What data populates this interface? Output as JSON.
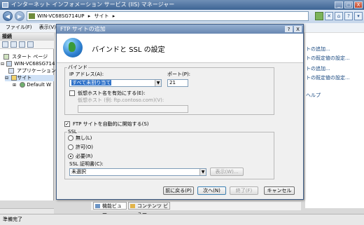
{
  "window": {
    "title": "インターネット インフォメーション サービス (IIS) マネージャー",
    "buttons": [
      "_",
      "□",
      "X"
    ]
  },
  "address": {
    "path": [
      "WIN-VC68SG714UP",
      "サイト"
    ],
    "separator": "▸"
  },
  "menu": {
    "items": [
      "ファイル(F)",
      "表示(V)",
      "?"
    ]
  },
  "connections": {
    "header": "接続",
    "tree": [
      {
        "label": "スタート ページ",
        "level": 1
      },
      {
        "label": "WIN-VC68SG714",
        "level": 1
      },
      {
        "label": "アプリケーション",
        "level": 2
      },
      {
        "label": "サイト",
        "level": 2
      },
      {
        "label": "Default W",
        "level": 3
      }
    ]
  },
  "actions": {
    "items": [
      "トの追加...",
      "トの既定値の設定...",
      "トの追加...",
      "トの既定値の設定...",
      "ヘルプ"
    ]
  },
  "view_tabs": {
    "features": "機能ビュー",
    "content": "コンテンツ ビュー"
  },
  "status": {
    "text": "準備完了"
  },
  "dialog": {
    "title": "FTP サイトの追加",
    "help_button": "?",
    "close_button": "X",
    "heading": "バインドと SSL の設定",
    "binding": {
      "group_label": "バインド",
      "ip_label": "IP アドレス(A):",
      "ip_value": "すべて未割り当て",
      "port_label": "ポート(P):",
      "port_value": "21",
      "virtual_host_checkbox": "仮想ホスト名を有効にする(E):",
      "virtual_host_label": "仮想ホスト (例: ftp.contoso.com)(V):",
      "virtual_host_value": "",
      "virtual_host_checked": false
    },
    "auto_start": {
      "label": "FTP サイトを自動的に開始する(S)",
      "checked": true
    },
    "ssl": {
      "group_label": "SSL",
      "options": [
        "無し(L)",
        "許可(O)",
        "必要(R)"
      ],
      "selected": "必要(R)",
      "cert_label": "SSL 証明書(C):",
      "cert_value": "未選択",
      "view_button": "表示(W)..."
    },
    "buttons": {
      "prev": "前に戻る(P)",
      "next": "次へ(N)",
      "finish": "終了(F)",
      "cancel": "キャンセル"
    }
  }
}
